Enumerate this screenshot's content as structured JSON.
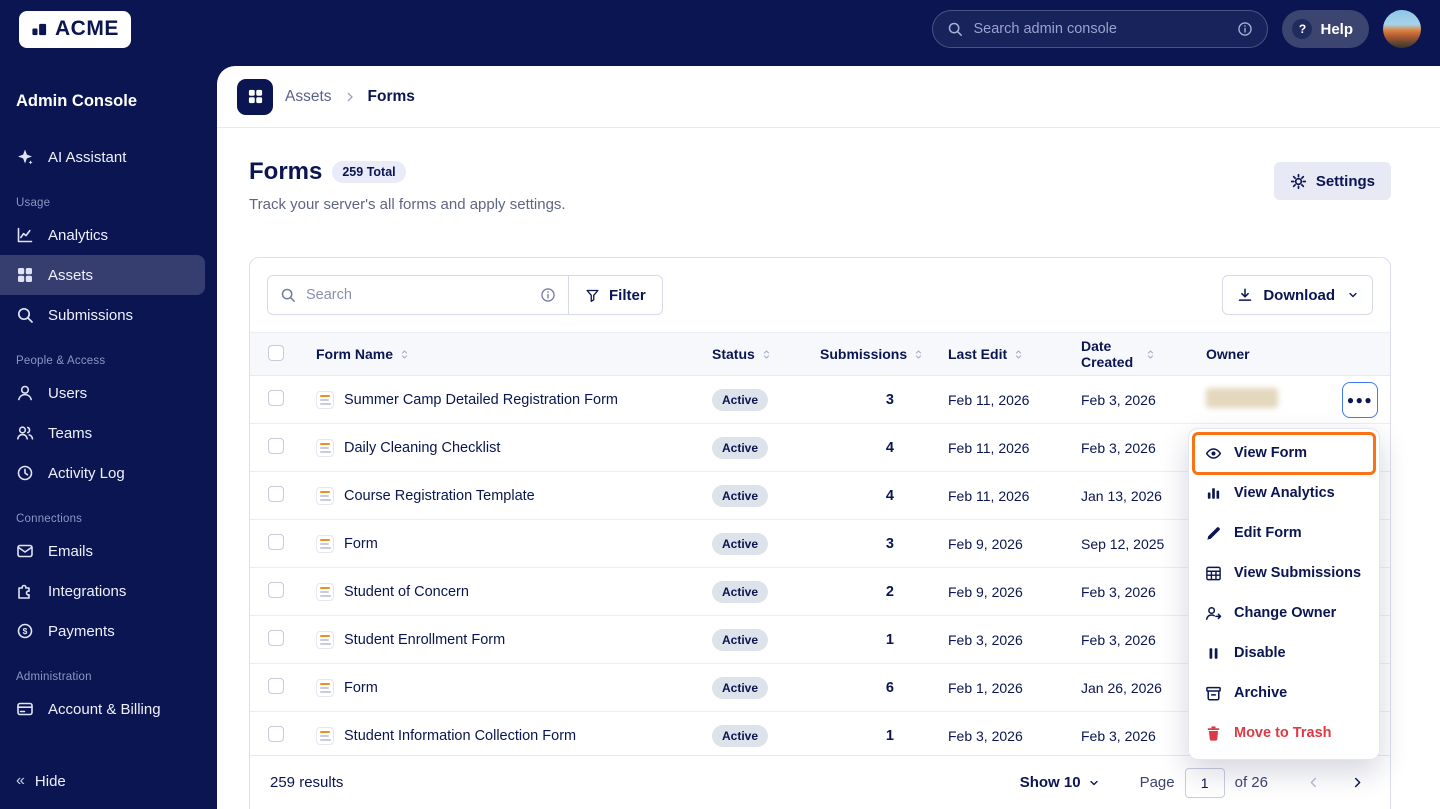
{
  "colors": {
    "navy": "#0a1551",
    "accent": "#f97316",
    "danger": "#dc3a45",
    "focus": "#4277f5"
  },
  "topbar": {
    "logo_text": "ACME",
    "search_placeholder": "Search admin console",
    "help_label": "Help",
    "icons": [
      "search-icon",
      "info-icon",
      "question-icon",
      "avatar"
    ]
  },
  "sidebar": {
    "title": "Admin Console",
    "assistant": {
      "label": "AI Assistant",
      "icon": "sparkle-icon"
    },
    "sections": [
      {
        "label": "Usage",
        "items": [
          {
            "label": "Analytics",
            "icon": "line-chart-icon"
          },
          {
            "label": "Assets",
            "icon": "grid-icon",
            "active": true
          },
          {
            "label": "Submissions",
            "icon": "search-icon"
          }
        ]
      },
      {
        "label": "People & Access",
        "items": [
          {
            "label": "Users",
            "icon": "user-icon"
          },
          {
            "label": "Teams",
            "icon": "users-icon"
          },
          {
            "label": "Activity Log",
            "icon": "clock-icon"
          }
        ]
      },
      {
        "label": "Connections",
        "items": [
          {
            "label": "Emails",
            "icon": "envelope-icon"
          },
          {
            "label": "Integrations",
            "icon": "puzzle-icon"
          },
          {
            "label": "Payments",
            "icon": "payments-icon"
          }
        ]
      },
      {
        "label": "Administration",
        "items": [
          {
            "label": "Account & Billing",
            "icon": "card-icon"
          }
        ]
      }
    ],
    "hide_label": "Hide"
  },
  "breadcrumb": {
    "parent": "Assets",
    "current": "Forms",
    "icon": "grid-icon"
  },
  "page": {
    "title": "Forms",
    "badge": "259 Total",
    "subtitle": "Track your server's all forms and apply settings.",
    "settings_label": "Settings"
  },
  "toolbar": {
    "search_placeholder": "Search",
    "filter_label": "Filter",
    "download_label": "Download"
  },
  "table": {
    "headers": [
      {
        "label": "Form Name",
        "sortable": true
      },
      {
        "label": "Status",
        "sortable": true
      },
      {
        "label": "Submissions",
        "sortable": true
      },
      {
        "label": "Last Edit",
        "sortable": true
      },
      {
        "label": "Date Created",
        "sortable": true
      },
      {
        "label": "Owner",
        "sortable": false
      }
    ],
    "rows": [
      {
        "name": "Summer Camp Detailed Registration Form",
        "status": "Active",
        "submissions": "3",
        "last_edit": "Feb 11, 2026",
        "date_created": "Feb 3, 2026"
      },
      {
        "name": "Daily Cleaning Checklist",
        "status": "Active",
        "submissions": "4",
        "last_edit": "Feb 11, 2026",
        "date_created": "Feb 3, 2026"
      },
      {
        "name": "Course Registration Template",
        "status": "Active",
        "submissions": "4",
        "last_edit": "Feb 11, 2026",
        "date_created": "Jan 13, 2026"
      },
      {
        "name": "Form",
        "status": "Active",
        "submissions": "3",
        "last_edit": "Feb 9, 2026",
        "date_created": "Sep 12, 2025"
      },
      {
        "name": "Student of Concern",
        "status": "Active",
        "submissions": "2",
        "last_edit": "Feb 9, 2026",
        "date_created": "Feb 3, 2026"
      },
      {
        "name": "Student Enrollment Form",
        "status": "Active",
        "submissions": "1",
        "last_edit": "Feb 3, 2026",
        "date_created": "Feb 3, 2026"
      },
      {
        "name": "Form",
        "status": "Active",
        "submissions": "6",
        "last_edit": "Feb 1, 2026",
        "date_created": "Jan 26, 2026"
      },
      {
        "name": "Student Information Collection Form",
        "status": "Active",
        "submissions": "1",
        "last_edit": "Feb 3, 2026",
        "date_created": "Feb 3, 2026"
      }
    ]
  },
  "menu": {
    "items": [
      {
        "label": "View Form",
        "icon": "eye-icon",
        "highlighted": true
      },
      {
        "label": "View Analytics",
        "icon": "bar-chart-icon"
      },
      {
        "label": "Edit Form",
        "icon": "pencil-icon"
      },
      {
        "label": "View Submissions",
        "icon": "table-icon"
      },
      {
        "label": "Change Owner",
        "icon": "user-swap-icon"
      },
      {
        "label": "Disable",
        "icon": "pause-icon"
      },
      {
        "label": "Archive",
        "icon": "archive-icon"
      },
      {
        "label": "Move to Trash",
        "icon": "trash-icon",
        "danger": true
      }
    ]
  },
  "footer": {
    "results": "259 results",
    "show_label": "Show 10",
    "page_label": "Page",
    "page_value": "1",
    "of_label": "of 26"
  }
}
